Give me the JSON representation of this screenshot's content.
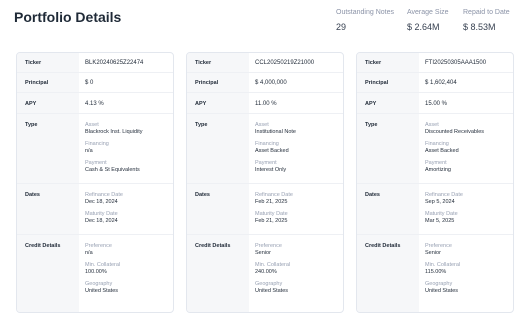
{
  "page": {
    "title": "Portfolio Details"
  },
  "stats": [
    {
      "label": "Outstanding Notes",
      "value": "29"
    },
    {
      "label": "Average Size",
      "value": "$ 2.64M"
    },
    {
      "label": "Repaid to Date",
      "value": "$ 8.53M"
    }
  ],
  "row_labels": {
    "ticker": "Ticker",
    "principal": "Principal",
    "apy": "APY",
    "type": "Type",
    "dates": "Dates",
    "credit": "Credit Details"
  },
  "field_labels": {
    "asset": "Asset",
    "financing": "Financing",
    "payment": "Payment",
    "refinance_date": "Refinance Date",
    "maturity_date": "Maturity Date",
    "preference": "Preference",
    "min_collateral": "Min. Collateral",
    "geography": "Geography"
  },
  "cards": [
    {
      "ticker": "BLK20240625Z22474",
      "principal": "$ 0",
      "apy": "4.13 %",
      "asset": "Blackrock Inst. Liquidity",
      "financing": "n/a",
      "payment": "Cash & St Equivalents",
      "refinance_date": "Dec 18, 2024",
      "maturity_date": "Dec 18, 2024",
      "preference": "n/a",
      "min_collateral": "100.00%",
      "geography": "United States"
    },
    {
      "ticker": "CCL20250219Z21000",
      "principal": "$ 4,000,000",
      "apy": "11.00 %",
      "asset": "Institutional Note",
      "financing": "Asset Backed",
      "payment": "Interest Only",
      "refinance_date": "Feb 21, 2025",
      "maturity_date": "Feb 21, 2025",
      "preference": "Senior",
      "min_collateral": "240.00%",
      "geography": "United States"
    },
    {
      "ticker": "FTI20250305AAA1500",
      "principal": "$ 1,602,404",
      "apy": "15.00 %",
      "asset": "Discounted Receivables",
      "financing": "Asset Backed",
      "payment": "Amortizing",
      "refinance_date": "Sep 5, 2024",
      "maturity_date": "Mar 5, 2025",
      "preference": "Senior",
      "min_collateral": "115.00%",
      "geography": "United States"
    }
  ]
}
